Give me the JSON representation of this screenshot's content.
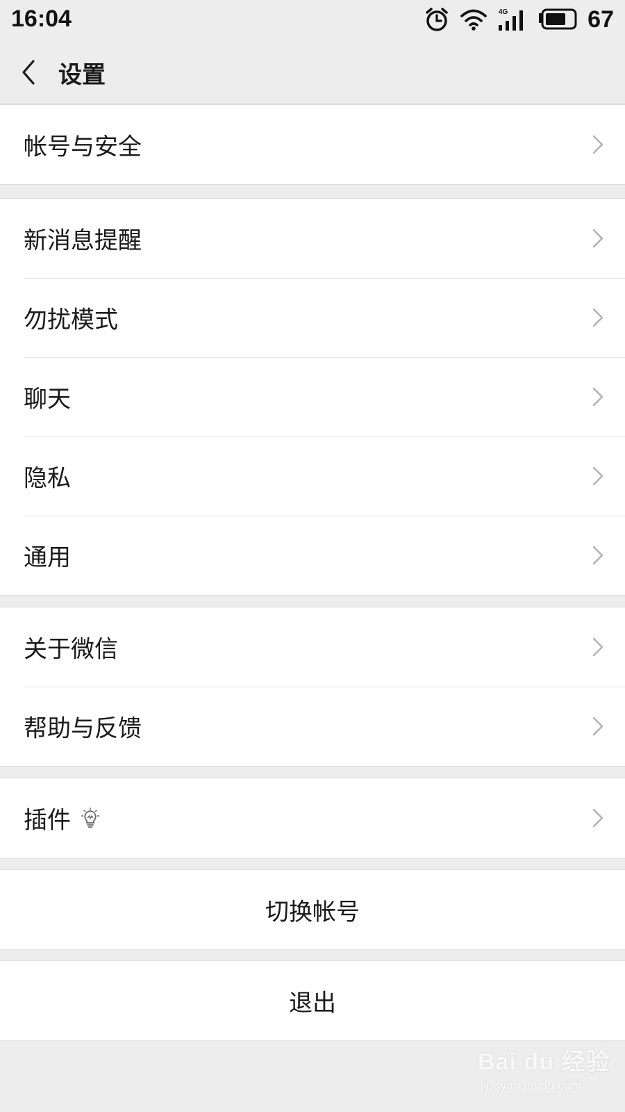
{
  "status_bar": {
    "time": "16:04",
    "network": "4G",
    "battery_percent": "67",
    "icons": [
      "alarm-icon",
      "wifi-icon",
      "signal-icon",
      "battery-icon"
    ]
  },
  "nav": {
    "back_icon": "chevron-left-icon",
    "title": "设置"
  },
  "groups": [
    {
      "items": [
        {
          "label": "帐号与安全"
        }
      ]
    },
    {
      "items": [
        {
          "label": "新消息提醒"
        },
        {
          "label": "勿扰模式"
        },
        {
          "label": "聊天"
        },
        {
          "label": "隐私"
        },
        {
          "label": "通用"
        }
      ]
    },
    {
      "items": [
        {
          "label": "关于微信"
        },
        {
          "label": "帮助与反馈"
        }
      ]
    },
    {
      "items": [
        {
          "label": "插件",
          "badge_icon": "lightbulb-icon"
        }
      ]
    }
  ],
  "actions": {
    "switch_account": "切换帐号",
    "logout": "退出"
  },
  "watermark": {
    "brand": "Bai du 经验",
    "url": "jingyan.baidu.com"
  },
  "colors": {
    "background": "#ededed",
    "card": "#ffffff",
    "text": "#1a1a1a",
    "chevron": "#b2b2b2"
  }
}
